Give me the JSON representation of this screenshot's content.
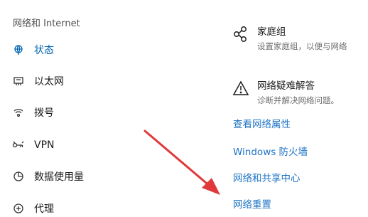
{
  "section_title": "网络和 Internet",
  "nav": [
    {
      "label": "状态",
      "icon": "globe-icon",
      "active": true
    },
    {
      "label": "以太网",
      "icon": "ethernet-icon"
    },
    {
      "label": "拨号",
      "icon": "dialup-icon"
    },
    {
      "label": "VPN",
      "icon": "vpn-icon"
    },
    {
      "label": "数据使用量",
      "icon": "data-usage-icon"
    },
    {
      "label": "代理",
      "icon": "proxy-icon"
    }
  ],
  "homegroup": {
    "title": "家庭组",
    "desc": "设置家庭组，以便与网络",
    "icon": "homegroup-icon"
  },
  "troubleshoot": {
    "title": "网络疑难解答",
    "desc": "诊断并解决网络问题。",
    "icon": "warning-icon"
  },
  "links": [
    "查看网络属性",
    "Windows 防火墙",
    "网络和共享中心",
    "网络重置"
  ],
  "colors": {
    "accent": "#0063b1",
    "link": "#1e73c4",
    "arrow": "#e0393b"
  }
}
